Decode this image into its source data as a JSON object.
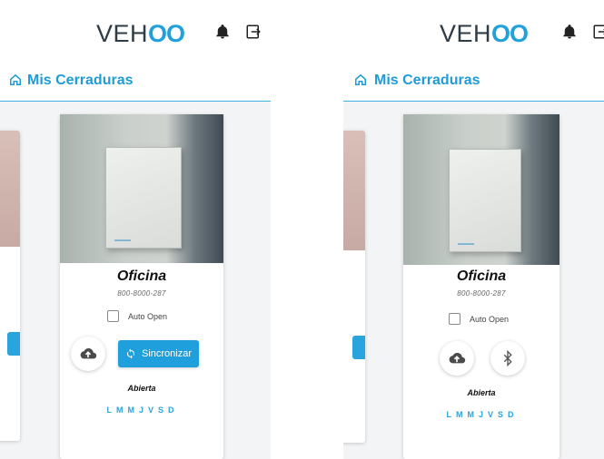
{
  "app": {
    "logo_prefix": "VEH",
    "logo_suffix": "OO",
    "page_title": "Mis Cerraduras"
  },
  "screens": [
    {
      "lock": {
        "name": "Oficina",
        "serial": "800-8000-287",
        "auto_open_label": "Auto Open",
        "auto_open_checked": false,
        "sync_label": "Sincronizar",
        "status": "Abierta",
        "days": [
          "L",
          "M",
          "M",
          "J",
          "V",
          "S",
          "D"
        ]
      }
    },
    {
      "lock": {
        "name": "Oficina",
        "serial": "800-8000-287",
        "auto_open_label": "Auto Open",
        "auto_open_checked": false,
        "status": "Abierta",
        "days": [
          "L",
          "M",
          "M",
          "J",
          "V",
          "S",
          "D"
        ]
      }
    }
  ],
  "colors": {
    "accent": "#1f9fdc",
    "logo_dark": "#2f3b45"
  },
  "icons": [
    "bell-icon",
    "logout-icon",
    "home-icon",
    "cloud-upload-icon",
    "sync-icon",
    "bluetooth-icon"
  ]
}
